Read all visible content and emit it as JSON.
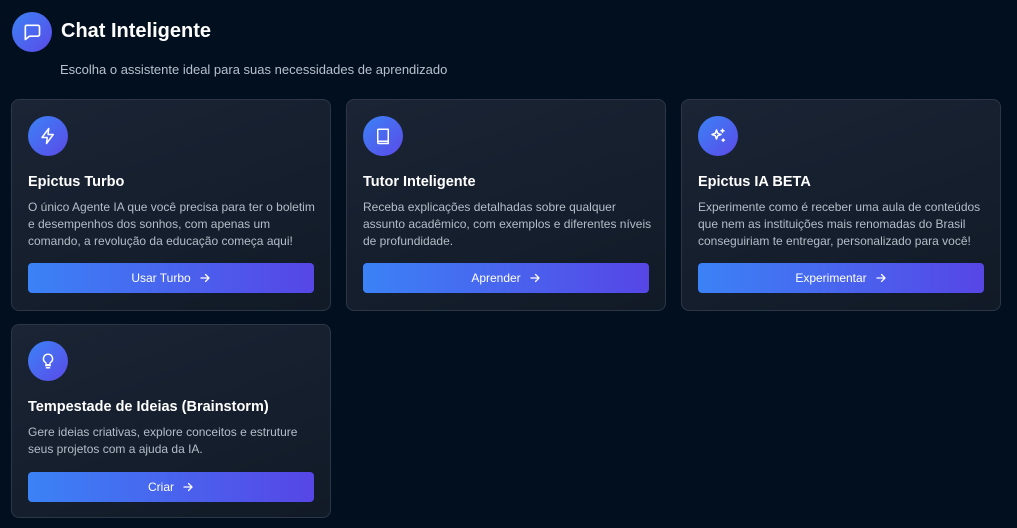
{
  "header": {
    "icon": "chat-bubble-icon",
    "title": "Chat Inteligente",
    "subtitle": "Escolha o assistente ideal para suas necessidades de aprendizado"
  },
  "theme": {
    "background": "#020f1f",
    "card_background": "#141e2c",
    "card_border": "#2c3644",
    "accent_start": "#3b82f6",
    "accent_end": "#5646e6"
  },
  "cards": [
    {
      "icon": "lightning-icon",
      "title": "Epictus Turbo",
      "description": "O único Agente IA que você precisa para ter o boletim e desempenhos dos sonhos, com apenas um comando, a revolução da educação começa aqui!",
      "button_label": "Usar Turbo"
    },
    {
      "icon": "book-icon",
      "title": "Tutor Inteligente",
      "description": "Receba explicações detalhadas sobre qualquer assunto acadêmico, com exemplos e diferentes níveis de profundidade.",
      "button_label": "Aprender"
    },
    {
      "icon": "sparkles-icon",
      "title": "Epictus IA BETA",
      "description": "Experimente como é receber uma aula de conteúdos que nem as instituições mais renomadas do Brasil conseguiriam te entregar, personalizado para você!",
      "button_label": "Experimentar"
    },
    {
      "icon": "lightbulb-icon",
      "title": "Tempestade de Ideias (Brainstorm)",
      "description": "Gere ideias criativas, explore conceitos e estruture seus projetos com a ajuda da IA.",
      "button_label": "Criar"
    }
  ]
}
